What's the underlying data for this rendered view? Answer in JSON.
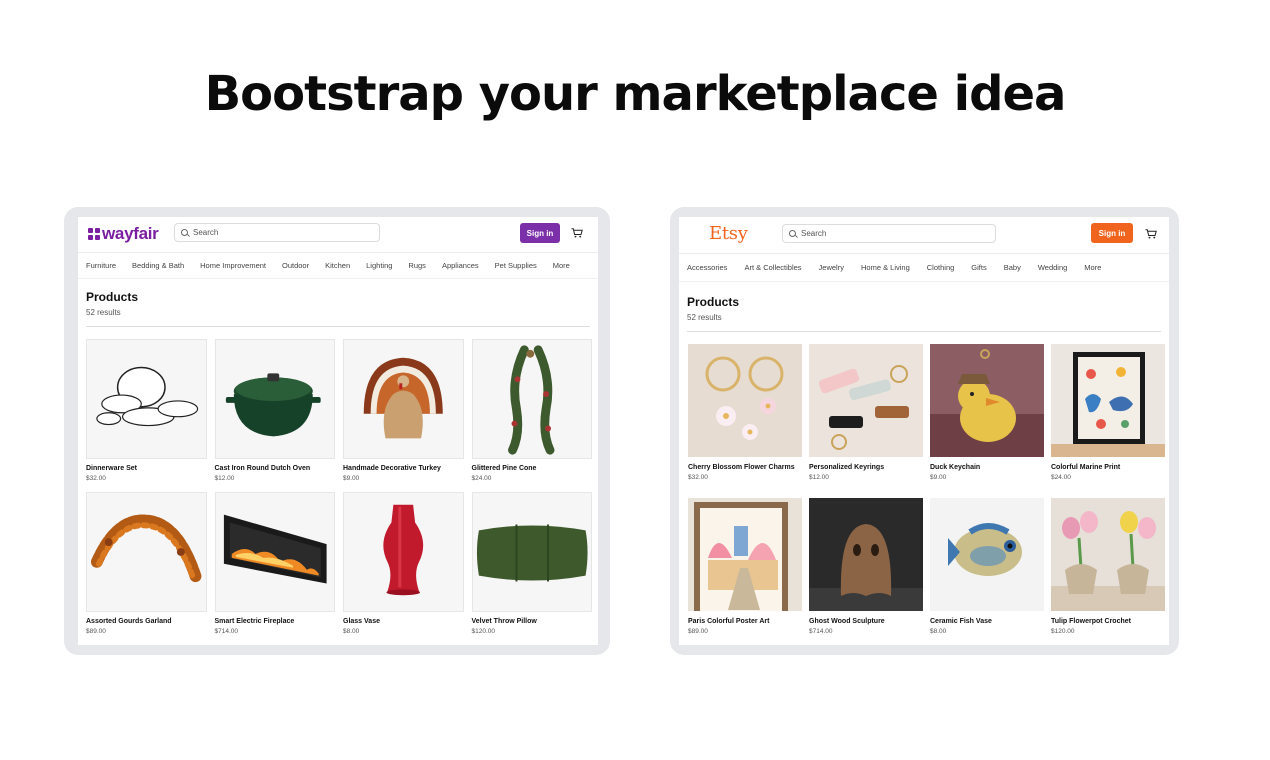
{
  "headline": "Bootstrap your marketplace idea",
  "wayfair": {
    "logo": "wayfair",
    "search_placeholder": "Search",
    "signin_label": "Sign in",
    "brand_color": "#7b2fa8",
    "nav": [
      "Furniture",
      "Bedding & Bath",
      "Home Improvement",
      "Outdoor",
      "Kitchen",
      "Lighting",
      "Rugs",
      "Appliances",
      "Pet Supplies",
      "More"
    ],
    "products_title": "Products",
    "products_count": "52 results",
    "products": [
      {
        "name": "Dinnerware Set",
        "price": "$32.00",
        "icon": "dinnerware-image"
      },
      {
        "name": "Cast Iron Round Dutch Oven",
        "price": "$12.00",
        "icon": "dutch-oven-image"
      },
      {
        "name": "Handmade Decorative Turkey",
        "price": "$9.00",
        "icon": "turkey-image"
      },
      {
        "name": "Glittered Pine Cone",
        "price": "$24.00",
        "icon": "pine-garland-image"
      },
      {
        "name": "Assorted Gourds Garland",
        "price": "$89.00",
        "icon": "leaf-garland-image"
      },
      {
        "name": "Smart Electric Fireplace",
        "price": "$714.00",
        "icon": "fireplace-image"
      },
      {
        "name": "Glass Vase",
        "price": "$8.00",
        "icon": "red-vase-image"
      },
      {
        "name": "Velvet Throw Pillow",
        "price": "$120.00",
        "icon": "pillow-image"
      }
    ]
  },
  "etsy": {
    "logo": "Etsy",
    "search_placeholder": "Search",
    "signin_label": "Sign in",
    "brand_color": "#f1641e",
    "nav": [
      "Accessories",
      "Art & Collectibles",
      "Jewelry",
      "Home & Living",
      "Clothing",
      "Gifts",
      "Baby",
      "Wedding",
      "More"
    ],
    "products_title": "Products",
    "products_count": "52 results",
    "products": [
      {
        "name": "Cherry Blossom Flower Charms",
        "price": "$32.00",
        "icon": "keyring-charms-image"
      },
      {
        "name": "Personalized Keyrings",
        "price": "$12.00",
        "icon": "keyrings-image"
      },
      {
        "name": "Duck Keychain",
        "price": "$9.00",
        "icon": "duck-keychain-image"
      },
      {
        "name": "Colorful Marine Print",
        "price": "$24.00",
        "icon": "marine-print-image"
      },
      {
        "name": "Paris Colorful Poster Art",
        "price": "$89.00",
        "icon": "paris-poster-image"
      },
      {
        "name": "Ghost Wood Sculpture",
        "price": "$714.00",
        "icon": "ghost-sculpture-image"
      },
      {
        "name": "Ceramic Fish Vase",
        "price": "$8.00",
        "icon": "fish-vase-image"
      },
      {
        "name": "Tulip Flowerpot Crochet",
        "price": "$120.00",
        "icon": "tulip-crochet-image"
      }
    ]
  }
}
